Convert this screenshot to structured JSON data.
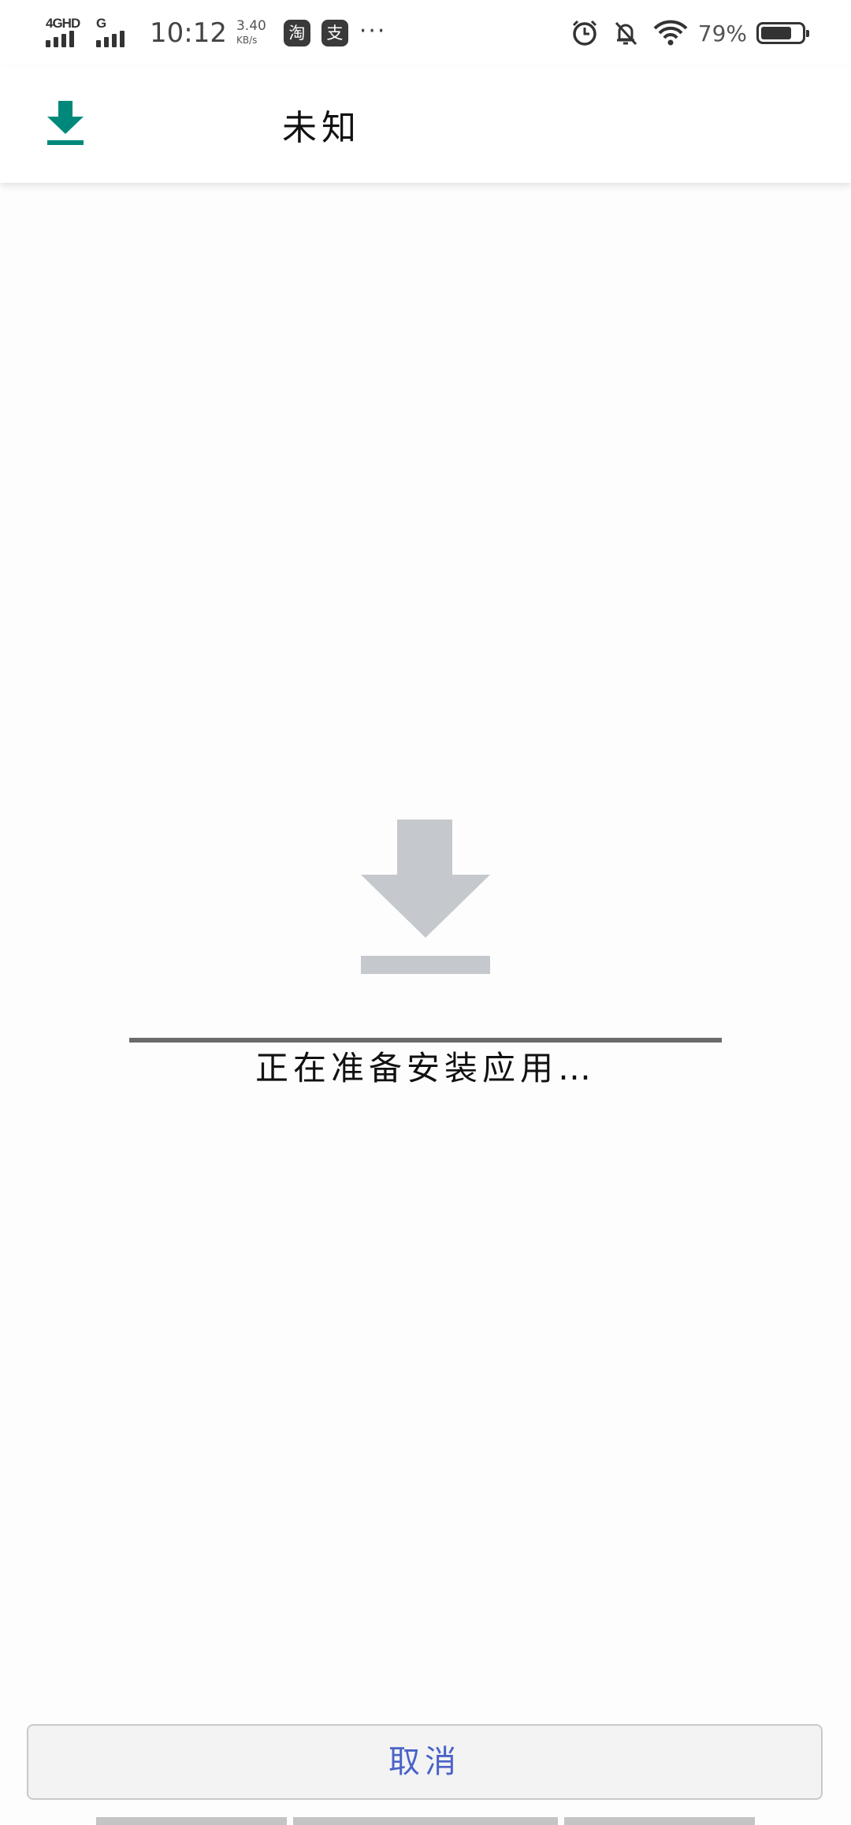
{
  "status_bar": {
    "network_1": "4GHD",
    "network_2": "G",
    "time": "10:12",
    "speed_value": "3.40",
    "speed_unit": "KB/s",
    "app_badge_1": "淘",
    "app_badge_2": "支",
    "more": "···",
    "battery_percent": "79%",
    "battery_level": 0.79,
    "icons": [
      "alarm-icon",
      "bell-muted-icon",
      "wifi-icon",
      "battery-icon"
    ]
  },
  "app_bar": {
    "icon": "download-icon",
    "title": "未知"
  },
  "main": {
    "icon": "download-icon",
    "progress": 1.0,
    "status_text": "正在准备安装应用…"
  },
  "footer": {
    "cancel_label": "取消"
  },
  "colors": {
    "accent": "#00897b",
    "icon_gray": "#c5c8cc",
    "button_text": "#4a63c8",
    "background": "#fdfdfd"
  }
}
